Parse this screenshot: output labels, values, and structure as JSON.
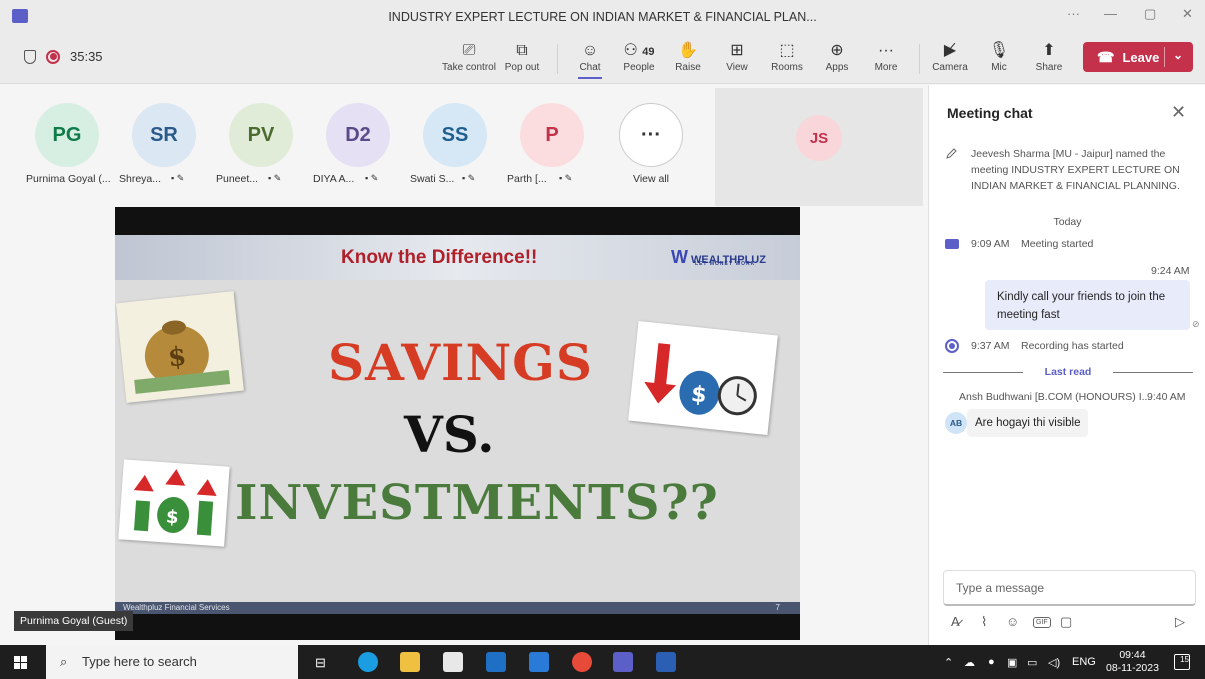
{
  "window": {
    "title": "INDUSTRY EXPERT LECTURE ON INDIAN MARKET & FINANCIAL PLAN...",
    "controls": [
      "···",
      "—",
      "▢",
      "✕"
    ]
  },
  "toolbar": {
    "timer": "35:35",
    "take_control": "Take control",
    "pop_out": "Pop out",
    "chat": "Chat",
    "people": "People",
    "people_count": "49",
    "raise": "Raise",
    "view": "View",
    "rooms": "Rooms",
    "apps": "Apps",
    "more": "More",
    "camera": "Camera",
    "mic": "Mic",
    "share": "Share",
    "leave": "Leave",
    "accent_color": "#5b5fc7",
    "leave_color": "#c4314b"
  },
  "participants": [
    {
      "initials": "PG",
      "name": "Purnima Goyal (...",
      "bg": "#d7efe3",
      "fg": "#0f7b4a"
    },
    {
      "initials": "SR",
      "name": "Shreya...",
      "bg": "#dbe7f3",
      "fg": "#2a5a8a"
    },
    {
      "initials": "PV",
      "name": "Puneet...",
      "bg": "#e1ecd8",
      "fg": "#4c6b31"
    },
    {
      "initials": "D2",
      "name": "DIYA A...",
      "bg": "#e5e0f3",
      "fg": "#5b4a8a"
    },
    {
      "initials": "SS",
      "name": "Swati S...",
      "bg": "#d6e8f5",
      "fg": "#1f5f8f"
    },
    {
      "initials": "P",
      "name": "Parth [...",
      "bg": "#fbdde0",
      "fg": "#c4314b"
    }
  ],
  "view_all": {
    "icon": "···",
    "label": "View all"
  },
  "featured_participant": {
    "initials": "JS"
  },
  "slide": {
    "heading": "Know the Difference!!",
    "logo_text": "WEALTHPLUZ",
    "logo_tagline": "LET MONEY WORK",
    "line1": "SAVINGS",
    "line2": "VS.",
    "line3": "INVESTMENTS??",
    "footer_text": "Wealthpluz Financial Services",
    "page_number": "7"
  },
  "presenter_label": "Purnima Goyal (Guest)",
  "chat": {
    "title": "Meeting chat",
    "system_rename": "Jeevesh Sharma [MU - Jaipur] named the meeting INDUSTRY EXPERT LECTURE ON INDIAN MARKET & FINANCIAL PLANNING.",
    "day_label": "Today",
    "meeting_started_time": "9:09 AM",
    "meeting_started_text": "Meeting started",
    "my_message_time": "9:24 AM",
    "my_message": "Kindly call your friends to join the meeting fast",
    "recording_time": "9:37 AM",
    "recording_text": "Recording has started",
    "last_read": "Last read",
    "incoming_sender": "Ansh Budhwani [B.COM (HONOURS) I...",
    "incoming_time": "9:40 AM",
    "incoming_avatar": "AB",
    "incoming_message": "Are hogayi thi visible",
    "compose_placeholder": "Type a message"
  },
  "taskbar": {
    "search_placeholder": "Type here to search",
    "language": "ENG",
    "time": "09:44",
    "date": "08-11-2023",
    "notifications": "15"
  }
}
